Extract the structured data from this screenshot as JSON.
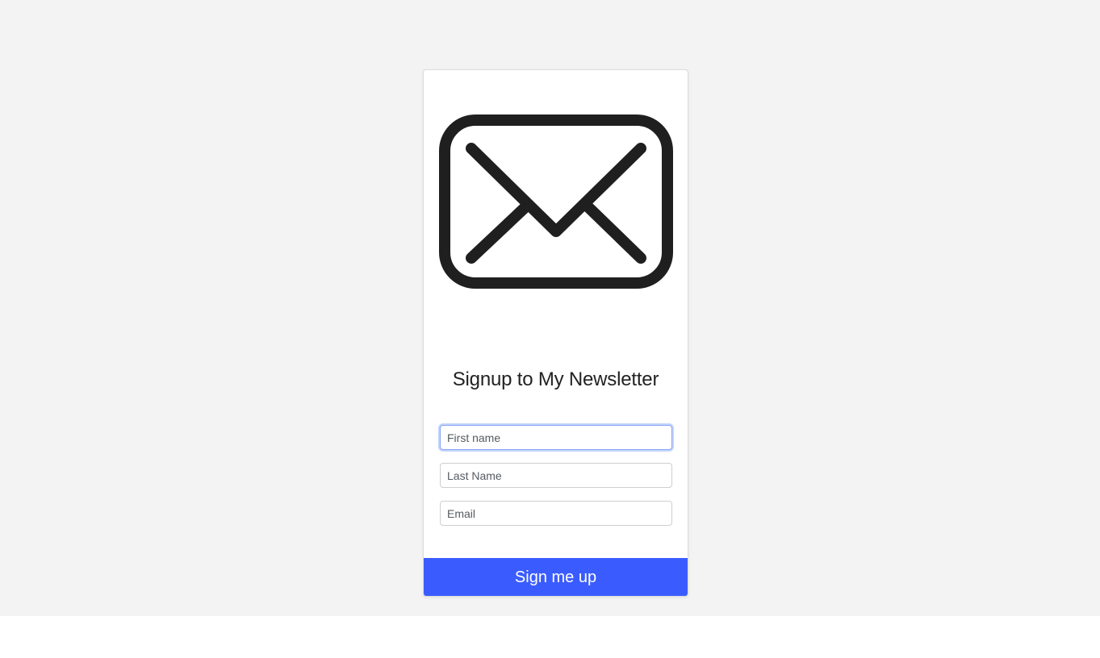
{
  "signup": {
    "title": "Signup to My Newsletter",
    "fields": {
      "first_name": {
        "placeholder": "First name",
        "value": ""
      },
      "last_name": {
        "placeholder": "Last Name",
        "value": ""
      },
      "email": {
        "placeholder": "Email",
        "value": ""
      }
    },
    "submit_label": "Sign me up",
    "icon": "envelope-icon",
    "colors": {
      "accent": "#3a5cff",
      "icon": "#1f1f1f",
      "background": "#f3f3f3"
    }
  }
}
